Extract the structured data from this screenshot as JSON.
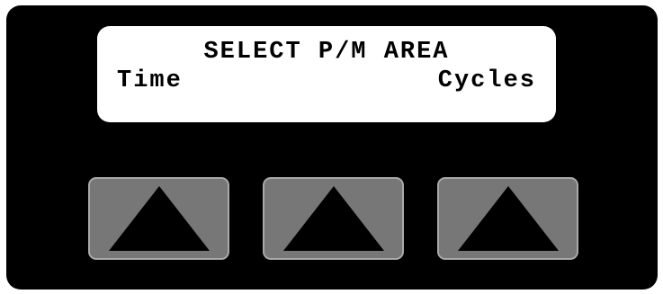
{
  "display": {
    "line1": "SELECT P/M AREA",
    "left_option": "Time",
    "right_option": "Cycles"
  },
  "softkeys": [
    {
      "icon": "triangle-up-icon"
    },
    {
      "icon": "triangle-up-icon"
    },
    {
      "icon": "triangle-up-icon"
    }
  ],
  "colors": {
    "panel": "#000000",
    "lcd_background": "#ffffff",
    "lcd_text": "#000000",
    "key_fill": "#777777",
    "key_border": "#a9a9a9",
    "arrow": "#000000"
  }
}
